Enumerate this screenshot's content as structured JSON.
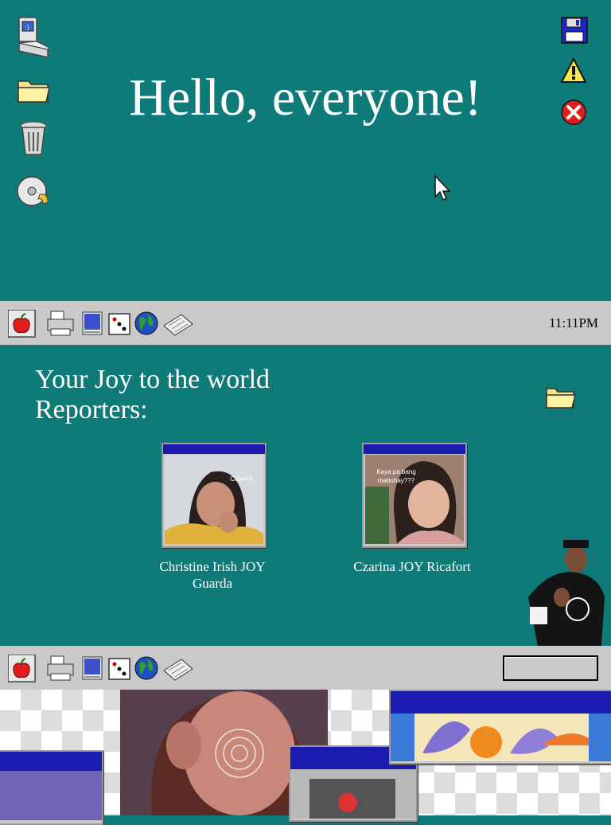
{
  "desktop": {
    "greeting": "Hello, everyone!",
    "left_icons": [
      "computer-icon",
      "folder-icon",
      "trash-icon",
      "cd-icon"
    ],
    "right_icons": [
      "floppy-disk-icon",
      "warning-icon",
      "close-icon"
    ]
  },
  "taskbar": {
    "clock": "11:11PM",
    "icons": [
      "printer-icon",
      "notepad-icon",
      "dice-icon",
      "globe-icon",
      "keyboard-icon"
    ]
  },
  "section": {
    "heading_line1": "Your Joy to the world",
    "heading_line2": "Reporters:",
    "reporters": [
      {
        "name": "Christine Irish JOY Guarda",
        "photo_overlay": "Cutie<3"
      },
      {
        "name": "Czarina JOY Ricafort",
        "photo_overlay": "Kaya pa bang mabuhay???"
      }
    ]
  },
  "colors": {
    "desktop": "#0f7b78",
    "taskbar": "#c9c9c9",
    "title_bar": "#1b1baf"
  }
}
